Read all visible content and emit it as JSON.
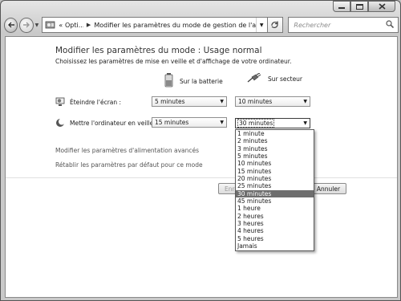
{
  "window": {
    "caption_buttons": [
      "minimize-icon",
      "maximize-icon",
      "close-icon"
    ]
  },
  "nav": {
    "back_icon": "back-arrow-icon",
    "forward_icon": "forward-arrow-icon",
    "address": {
      "overflow": "«",
      "crumb1": "Opti...",
      "crumb2": "Modifier les paramètres du mode de gestion de l'ali..."
    },
    "search_placeholder": "Rechercher"
  },
  "page": {
    "title": "Modifier les paramètres du mode : Usage normal",
    "subtitle": "Choisissez les paramètres de mise en veille et d'affichage de votre ordinateur.",
    "col_battery": "Sur la batterie",
    "col_ac": "Sur secteur",
    "row1_label": "Éteindre l'écran :",
    "row1_battery": "5 minutes",
    "row1_ac": "10 minutes",
    "row2_label": "Mettre l'ordinateur en veille :",
    "row2_battery": "15 minutes",
    "row2_ac": "30 minutes",
    "link_advanced": "Modifier les paramètres d'alimentation avancés",
    "link_restore": "Rétablir les paramètres par défaut pour ce mode",
    "save_button": "Enre",
    "cancel_button": "Annuler"
  },
  "dropdown": {
    "selected": "30 minutes",
    "options": [
      "1 minute",
      "2 minutes",
      "3 minutes",
      "5 minutes",
      "10 minutes",
      "15 minutes",
      "20 minutes",
      "25 minutes",
      "30 minutes",
      "45 minutes",
      "1 heure",
      "2 heures",
      "3 heures",
      "4 heures",
      "5 heures",
      "Jamais"
    ]
  }
}
